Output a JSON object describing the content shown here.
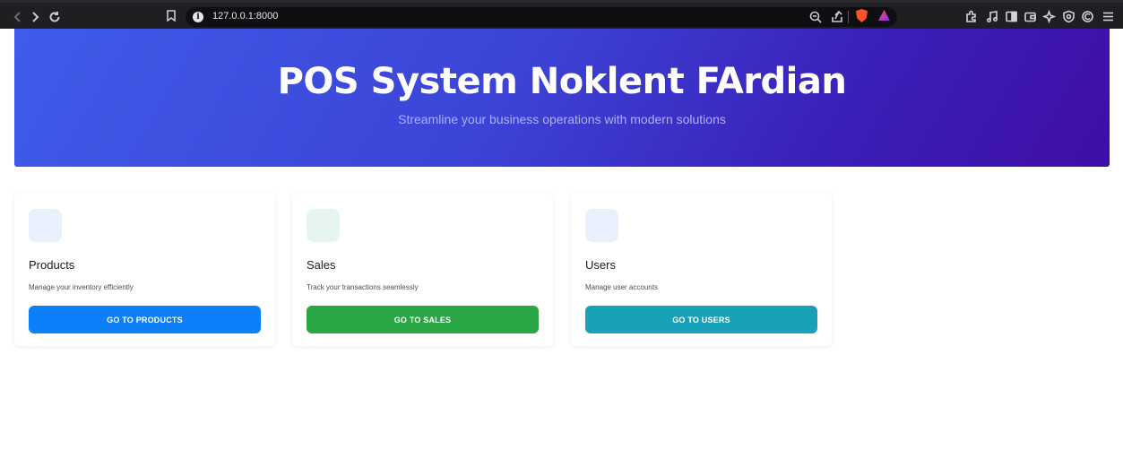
{
  "browser": {
    "url": "127.0.0.1:8000"
  },
  "hero": {
    "title": "POS System Noklent FArdian",
    "subtitle": "Streamline your business operations with modern solutions"
  },
  "cards": [
    {
      "title": "Products",
      "description": "Manage your inventory efficiently",
      "button_label": "GO TO PRODUCTS",
      "button_color": "#0d7ff9",
      "icon_bg": "#e9effc"
    },
    {
      "title": "Sales",
      "description": "Track your transactions seamlessly",
      "button_label": "GO TO SALES",
      "button_color": "#29a745",
      "icon_bg": "#e6f5ee"
    },
    {
      "title": "Users",
      "description": "Manage user accounts",
      "button_label": "GO TO USERS",
      "button_color": "#17a2b8",
      "icon_bg": "#e9effc"
    }
  ]
}
